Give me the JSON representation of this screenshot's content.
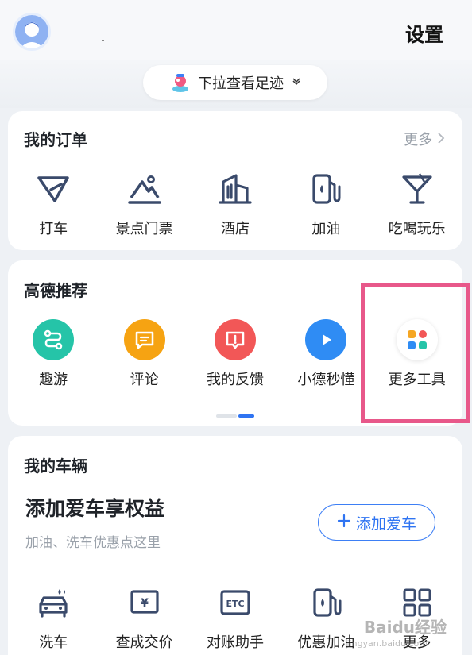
{
  "header": {
    "settings_label": "设置"
  },
  "footprint": {
    "label": "下拉查看足迹"
  },
  "orders": {
    "title": "我的订单",
    "more_label": "更多",
    "items": [
      {
        "label": "打车",
        "icon": "taxi-icon"
      },
      {
        "label": "景点门票",
        "icon": "scenic-ticket-icon"
      },
      {
        "label": "酒店",
        "icon": "hotel-icon"
      },
      {
        "label": "加油",
        "icon": "fuel-icon"
      },
      {
        "label": "吃喝玩乐",
        "icon": "cocktail-icon"
      }
    ]
  },
  "recommend": {
    "title": "高德推荐",
    "items": [
      {
        "label": "趣游",
        "icon": "route-icon",
        "color": "#25c4a8"
      },
      {
        "label": "评论",
        "icon": "comment-icon",
        "color": "#f6a312"
      },
      {
        "label": "我的反馈",
        "icon": "feedback-icon",
        "color": "#f25757"
      },
      {
        "label": "小德秒懂",
        "icon": "play-icon",
        "color": "#2f8cf4"
      },
      {
        "label": "更多工具",
        "icon": "apps-icon",
        "color": "#ffffff"
      }
    ],
    "pager": {
      "pages": 2,
      "active": 2
    },
    "highlight_color": "#e8588a"
  },
  "vehicle": {
    "title": "我的车辆",
    "headline": "添加爱车享权益",
    "subtitle": "加油、洗车优惠点这里",
    "add_button": "添加爱车",
    "items": [
      {
        "label": "洗车",
        "icon": "car-wash-icon"
      },
      {
        "label": "查成交价",
        "icon": "price-tag-icon"
      },
      {
        "label": "对账助手",
        "icon": "etc-icon"
      },
      {
        "label": "优惠加油",
        "icon": "fuel-discount-icon"
      },
      {
        "label": "更多",
        "icon": "grid-more-icon"
      }
    ]
  },
  "watermark": {
    "text": "Baidu经验",
    "sub": "jingyan.baidu.com"
  },
  "colors": {
    "accent": "#2f74f2",
    "icon_stroke": "#3a4a6b"
  }
}
